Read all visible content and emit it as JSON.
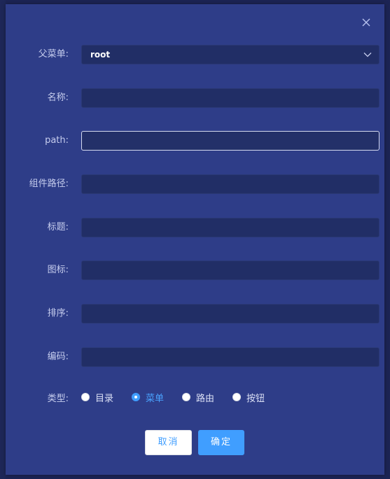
{
  "form": {
    "parent_menu": {
      "label": "父菜单:",
      "value": "root"
    },
    "name": {
      "label": "名称:",
      "value": ""
    },
    "path": {
      "label": "path:",
      "value": ""
    },
    "component_path": {
      "label": "组件路径:",
      "value": ""
    },
    "title": {
      "label": "标题:",
      "value": ""
    },
    "icon": {
      "label": "图标:",
      "value": ""
    },
    "sort": {
      "label": "排序:",
      "value": ""
    },
    "code": {
      "label": "编码:",
      "value": ""
    },
    "type": {
      "label": "类型:",
      "options": [
        "目录",
        "菜单",
        "路由",
        "按钮"
      ],
      "selected": "菜单"
    }
  },
  "buttons": {
    "cancel": "取消",
    "confirm": "确定"
  },
  "colors": {
    "dialog_bg": "#2e3d88",
    "input_bg": "#212e66",
    "accent": "#409eff"
  },
  "icons": {
    "close": "close-icon",
    "dropdown": "chevron-down-icon"
  }
}
